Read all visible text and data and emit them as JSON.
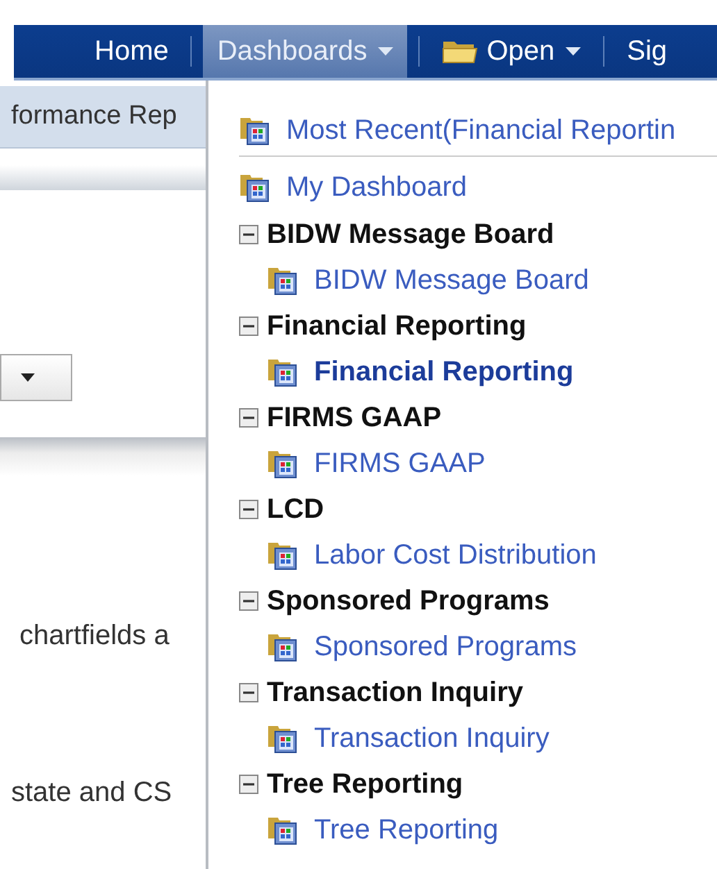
{
  "nav": {
    "items": [
      {
        "label": "Home",
        "kind": "link",
        "selected": false
      },
      {
        "label": "Dashboards",
        "kind": "menu",
        "selected": true
      },
      {
        "label": "Open",
        "kind": "folder_menu",
        "selected": false
      },
      {
        "label": "Sig",
        "kind": "link",
        "selected": false
      }
    ]
  },
  "page": {
    "tab_label": "formance Rep",
    "texts": [
      "chartfields a",
      "state and CS"
    ]
  },
  "menu": {
    "items": [
      {
        "label": "Most Recent(Financial Reportin"
      },
      {
        "label": "My Dashboard"
      }
    ],
    "groups": [
      {
        "title": "BIDW Message Board",
        "expanded": true,
        "children": [
          {
            "label": "BIDW Message Board",
            "selected": false
          }
        ]
      },
      {
        "title": "Financial Reporting",
        "expanded": true,
        "children": [
          {
            "label": "Financial Reporting",
            "selected": true
          }
        ]
      },
      {
        "title": "FIRMS GAAP",
        "expanded": true,
        "children": [
          {
            "label": "FIRMS GAAP",
            "selected": false
          }
        ]
      },
      {
        "title": "LCD",
        "expanded": true,
        "children": [
          {
            "label": "Labor Cost Distribution",
            "selected": false
          }
        ]
      },
      {
        "title": "Sponsored Programs",
        "expanded": true,
        "children": [
          {
            "label": "Sponsored Programs",
            "selected": false
          }
        ]
      },
      {
        "title": "Transaction Inquiry",
        "expanded": true,
        "children": [
          {
            "label": "Transaction Inquiry",
            "selected": false
          }
        ]
      },
      {
        "title": "Tree Reporting",
        "expanded": true,
        "children": [
          {
            "label": "Tree Reporting",
            "selected": false
          }
        ]
      }
    ]
  }
}
